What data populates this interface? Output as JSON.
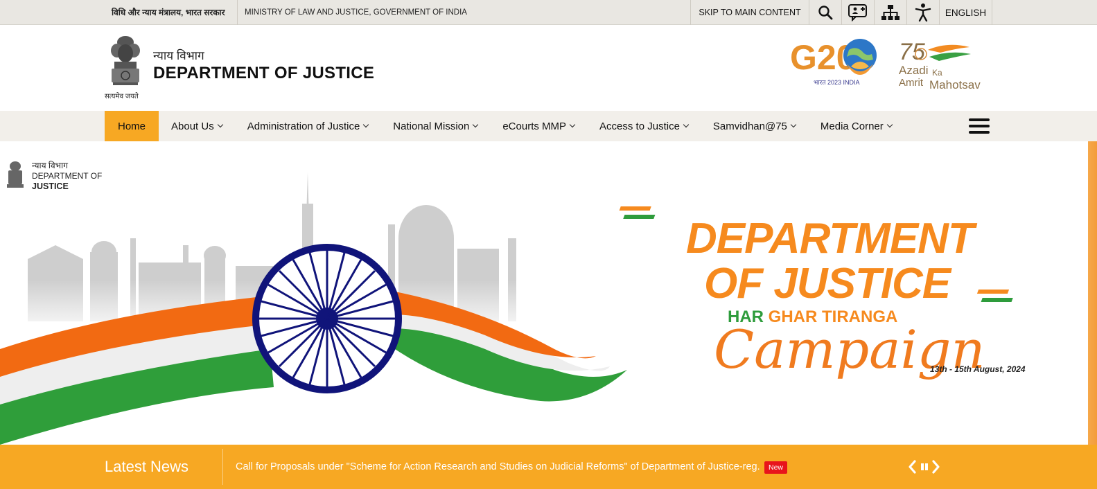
{
  "topbar": {
    "hindi_gov": "विधि और न्याय मंत्रालय, भारत सरकार",
    "ministry": "MINISTRY OF LAW AND JUSTICE, GOVERNMENT OF INDIA",
    "skip": "SKIP TO MAIN CONTENT",
    "icons": [
      "search-icon",
      "feedback-chat-icon",
      "sitemap-icon",
      "accessibility-icon"
    ],
    "language": "ENGLISH"
  },
  "header": {
    "emblem_motto": "सत्यमेव जयते",
    "dept_hindi": "न्याय विभाग",
    "dept_name": "DEPARTMENT OF JUSTICE",
    "g20_text": "G20",
    "g20_sub": "भारत 2023 INDIA",
    "azadi_line1": "Azadi",
    "azadi_ka": "Ka",
    "azadi_line2": "Amrit",
    "azadi_mahotsav": "Mahotsav",
    "azadi_75": "75"
  },
  "nav": {
    "items": [
      {
        "label": "Home"
      },
      {
        "label": "About Us"
      },
      {
        "label": "Administration of Justice"
      },
      {
        "label": "National Mission"
      },
      {
        "label": "eCourts MMP"
      },
      {
        "label": "Access to Justice"
      },
      {
        "label": "Samvidhan@75"
      },
      {
        "label": "Media Corner"
      }
    ]
  },
  "banner": {
    "mini_logo_hindi": "न्याय विभाग",
    "mini_logo_line1": "DEPARTMENT OF",
    "mini_logo_line2": "JUSTICE",
    "headline_line1": "DEPARTMENT",
    "headline_line2": "OF JUSTICE",
    "har": "HAR",
    "ghar_tiranga": "GHAR TIRANGA",
    "campaign": "Campaign",
    "dates": "13th - 15th August, 2024"
  },
  "news": {
    "title": "Latest News",
    "item": "Call for Proposals under \"Scheme for Action Research and Studies on Judicial Reforms\" of Department of Justice-reg.",
    "badge": "New"
  },
  "colors": {
    "accent": "#f7a823",
    "saffron": "#f68a1e",
    "green": "#2e9c3c",
    "navy": "#10147a"
  }
}
